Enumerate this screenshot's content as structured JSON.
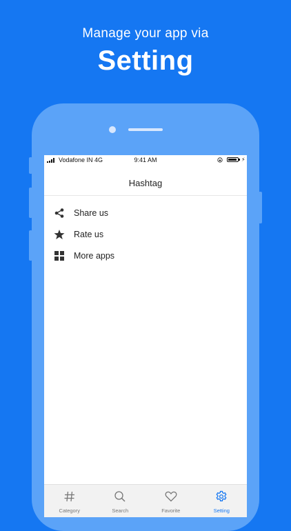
{
  "promo": {
    "subtitle": "Manage your app via",
    "title": "Setting"
  },
  "status_bar": {
    "carrier": "Vodafone IN 4G",
    "time": "9:41 AM"
  },
  "nav": {
    "title": "Hashtag"
  },
  "menu": {
    "items": [
      {
        "label": "Share us",
        "icon": "share-icon"
      },
      {
        "label": "Rate us",
        "icon": "star-icon"
      },
      {
        "label": "More apps",
        "icon": "grid-icon"
      }
    ]
  },
  "tabbar": {
    "tabs": [
      {
        "label": "Category",
        "icon": "hashtag-icon",
        "active": false
      },
      {
        "label": "Search",
        "icon": "search-icon",
        "active": false
      },
      {
        "label": "Favorite",
        "icon": "heart-icon",
        "active": false
      },
      {
        "label": "Setting",
        "icon": "gear-icon",
        "active": true
      }
    ]
  },
  "colors": {
    "background": "#1577f2",
    "phone": "#5ba3f8",
    "accent": "#1577f2"
  }
}
